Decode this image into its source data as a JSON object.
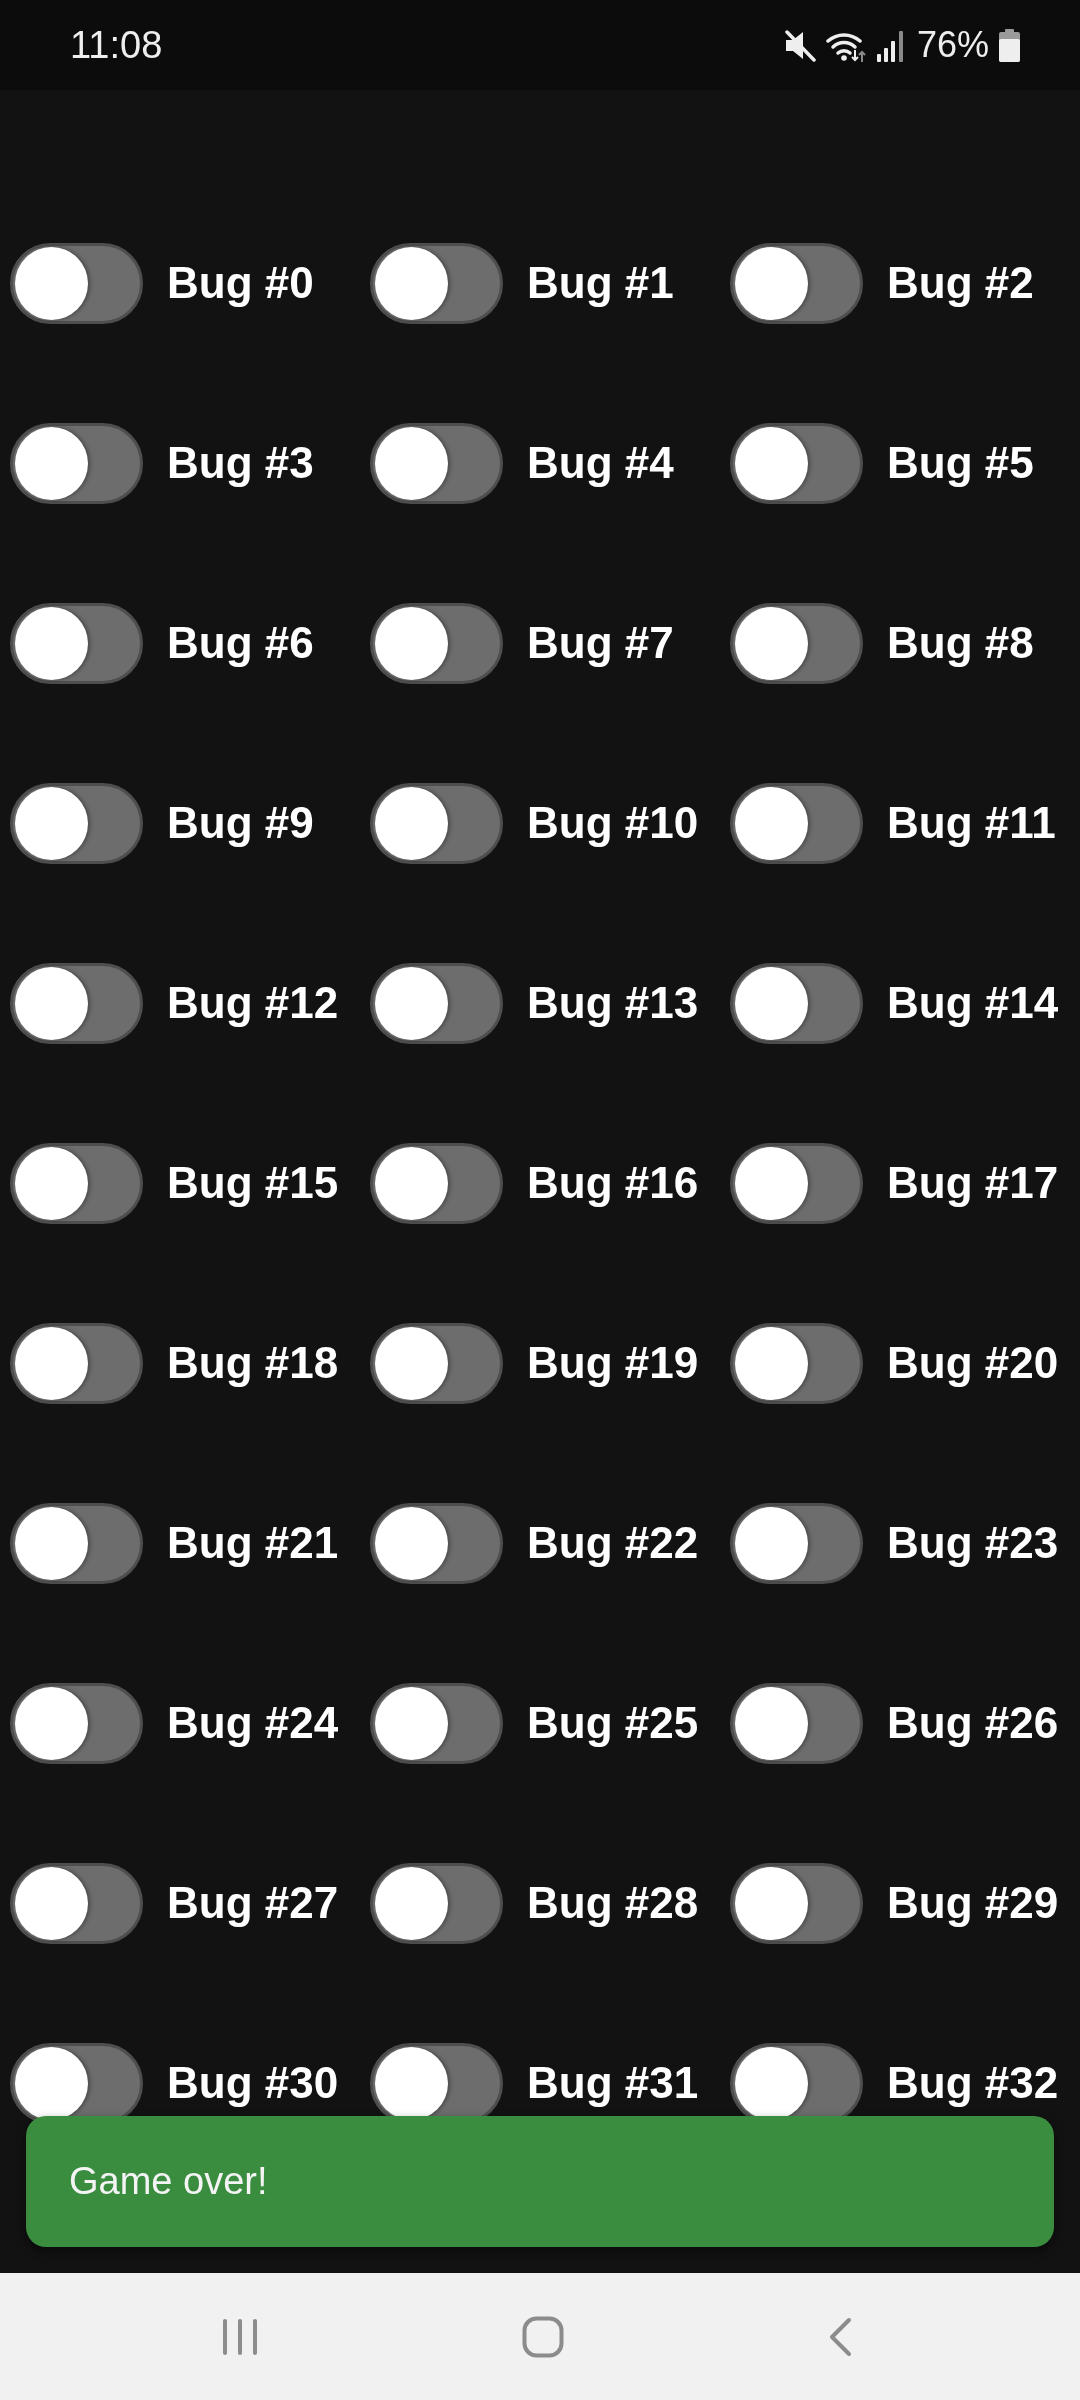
{
  "status_bar": {
    "time": "11:08",
    "battery": "76%"
  },
  "switches": [
    {
      "label": "Bug #0",
      "on": false
    },
    {
      "label": "Bug #1",
      "on": false
    },
    {
      "label": "Bug #2",
      "on": false
    },
    {
      "label": "Bug #3",
      "on": false
    },
    {
      "label": "Bug #4",
      "on": false
    },
    {
      "label": "Bug #5",
      "on": false
    },
    {
      "label": "Bug #6",
      "on": false
    },
    {
      "label": "Bug #7",
      "on": false
    },
    {
      "label": "Bug #8",
      "on": false
    },
    {
      "label": "Bug #9",
      "on": false
    },
    {
      "label": "Bug #10",
      "on": false
    },
    {
      "label": "Bug #11",
      "on": false
    },
    {
      "label": "Bug #12",
      "on": false
    },
    {
      "label": "Bug #13",
      "on": false
    },
    {
      "label": "Bug #14",
      "on": false
    },
    {
      "label": "Bug #15",
      "on": false
    },
    {
      "label": "Bug #16",
      "on": false
    },
    {
      "label": "Bug #17",
      "on": false
    },
    {
      "label": "Bug #18",
      "on": false
    },
    {
      "label": "Bug #19",
      "on": false
    },
    {
      "label": "Bug #20",
      "on": false
    },
    {
      "label": "Bug #21",
      "on": false
    },
    {
      "label": "Bug #22",
      "on": false
    },
    {
      "label": "Bug #23",
      "on": false
    },
    {
      "label": "Bug #24",
      "on": false
    },
    {
      "label": "Bug #25",
      "on": false
    },
    {
      "label": "Bug #26",
      "on": false
    },
    {
      "label": "Bug #27",
      "on": false
    },
    {
      "label": "Bug #28",
      "on": false
    },
    {
      "label": "Bug #29",
      "on": false
    },
    {
      "label": "Bug #30",
      "on": false
    },
    {
      "label": "Bug #31",
      "on": false
    },
    {
      "label": "Bug #32",
      "on": false
    }
  ],
  "toast": {
    "message": "Game over!"
  }
}
